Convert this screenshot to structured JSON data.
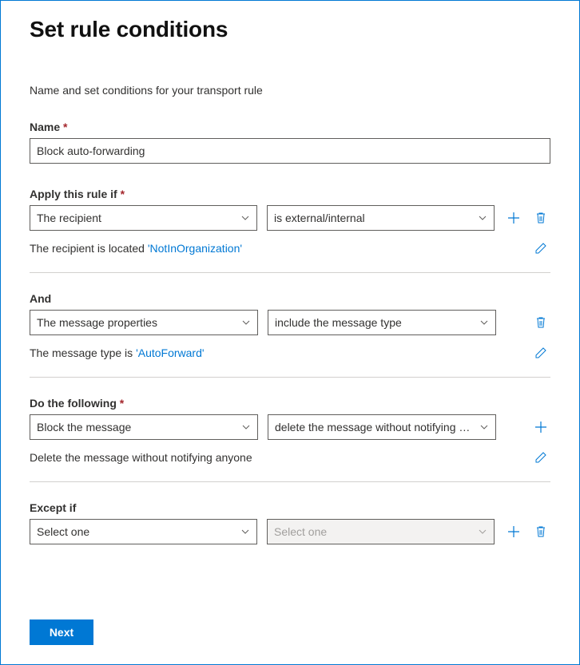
{
  "title": "Set rule conditions",
  "subtitle": "Name and set conditions for your transport rule",
  "name": {
    "label": "Name",
    "value": "Block auto-forwarding"
  },
  "apply": {
    "label": "Apply this rule if",
    "select1": "The recipient",
    "select2": "is external/internal",
    "summary_prefix": "The recipient is located ",
    "summary_value": "'NotInOrganization'"
  },
  "and": {
    "label": "And",
    "select1": "The message properties",
    "select2": "include the message type",
    "summary_prefix": "The message type is ",
    "summary_value": "'AutoForward'"
  },
  "do": {
    "label": "Do the following",
    "select1": "Block the message",
    "select2": "delete the message without notifying …",
    "summary": "Delete the message without notifying anyone"
  },
  "except": {
    "label": "Except if",
    "select1": "Select one",
    "select2": "Select one"
  },
  "footer": {
    "next": "Next"
  }
}
